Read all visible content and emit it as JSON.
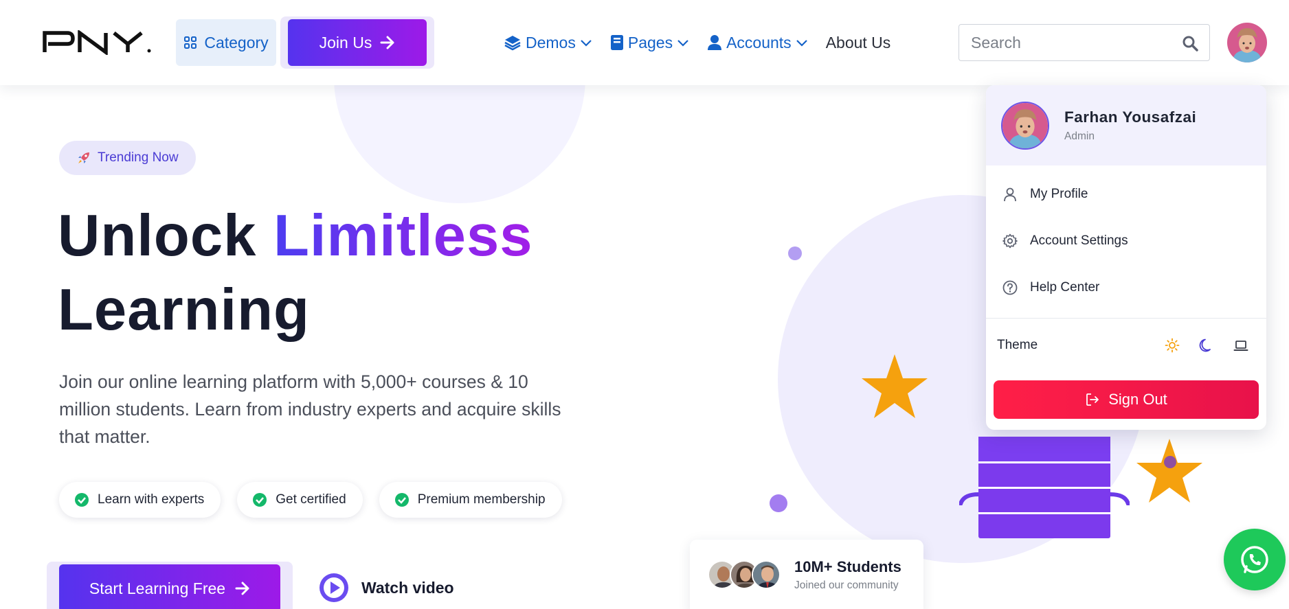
{
  "navbar": {
    "logo_text": "PNY",
    "category_label": "Category",
    "join_label": "Join Us",
    "menu": [
      {
        "label": "Demos",
        "icon": "layers-icon"
      },
      {
        "label": "Pages",
        "icon": "book-icon"
      },
      {
        "label": "Accounts",
        "icon": "user-icon"
      },
      {
        "label": "About Us"
      }
    ],
    "search_placeholder": "Search"
  },
  "hero": {
    "badge": "Trending Now",
    "headline_part1": "Unlock ",
    "headline_highlight": "Limitless",
    "headline_part2": "Learning",
    "description": "Join our online learning platform with 5,000+ courses & 10 million students. Learn from industry experts and acquire skills that matter.",
    "features": [
      "Learn with experts",
      "Get certified",
      "Premium membership"
    ],
    "cta_label": "Start Learning Free",
    "watch_label": "Watch video"
  },
  "students_card": {
    "title": "10M+ Students",
    "subtitle": "Joined our community"
  },
  "profile_menu": {
    "name": "Farhan Yousafzai",
    "role": "Admin",
    "items": [
      "My Profile",
      "Account Settings",
      "Help Center"
    ],
    "theme_label": "Theme",
    "theme_options": [
      "sun-icon",
      "moon-icon",
      "laptop-icon"
    ],
    "signout_label": "Sign Out"
  },
  "colors": {
    "brand_blue": "#1462c8",
    "gradient_start": "#5533ee",
    "gradient_end": "#9d1ae8",
    "accent_green": "#1ec95a",
    "danger": "#ff1f47",
    "star": "#f5a10e"
  }
}
